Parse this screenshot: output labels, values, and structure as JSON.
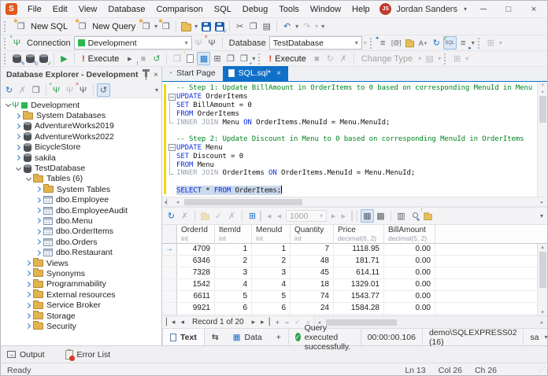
{
  "titlebar": {
    "menus": [
      "File",
      "Edit",
      "View",
      "Database",
      "Comparison",
      "SQL",
      "Debug",
      "Tools",
      "Window",
      "Help"
    ],
    "user": "Jordan Sanders",
    "user_initials": "JS"
  },
  "icons": {
    "plug": "Ψ",
    "undo": "↶",
    "redo": "↷",
    "cut": "✂",
    "copy": "❐",
    "paste": "▤",
    "refresh": "↻",
    "cancel": "✗",
    "accept": "✓",
    "reject": "✗",
    "play": "▶",
    "stop": "■",
    "history": "↺",
    "chev": "▾",
    "star": "✱",
    "win": "❐",
    "grid": "▦",
    "cards": "▩",
    "cols": "▥",
    "export": "↑",
    "swap": "⇆",
    "at": "[@]",
    "aplus": "A+",
    "sql": "SQL",
    "outdent": "≡",
    "pencil": "✎",
    "clock": "↻",
    "check": "✓",
    "arrow": "→",
    "tri_l": "◂",
    "tri_r": "▸",
    "tri_u": "▴",
    "tri_d": "▾",
    "plus": "+",
    "minus": "−",
    "cross": "×",
    "min": "─",
    "max": "□",
    "close": "×",
    "excl": "!",
    "split": "÷",
    "gear": "⊞"
  },
  "toolbar1": {
    "new_sql": "New SQL",
    "new_query": "New Query"
  },
  "toolbar2": {
    "connection_label": "Connection",
    "connection_value": "Development",
    "database_label": "Database",
    "database_value": "TestDatabase"
  },
  "toolbar3": {
    "execute1": "Execute",
    "execute2": "Execute",
    "change_type": "Change Type"
  },
  "explorer": {
    "title": "Database Explorer - Development",
    "tree": [
      {
        "label": "Development",
        "level": 0,
        "icon": "server",
        "expand": "open"
      },
      {
        "label": "System Databases",
        "level": 1,
        "icon": "folder",
        "expand": "closed"
      },
      {
        "label": "AdventureWorks2019",
        "level": 1,
        "icon": "db",
        "expand": "closed"
      },
      {
        "label": "AdventureWorks2022",
        "level": 1,
        "icon": "db",
        "expand": "closed"
      },
      {
        "label": "BicycleStore",
        "level": 1,
        "icon": "db",
        "expand": "closed"
      },
      {
        "label": "sakila",
        "level": 1,
        "icon": "db",
        "expand": "closed"
      },
      {
        "label": "TestDatabase",
        "level": 1,
        "icon": "db",
        "expand": "open"
      },
      {
        "label": "Tables (6)",
        "level": 2,
        "icon": "folder-open",
        "expand": "open"
      },
      {
        "label": "System Tables",
        "level": 3,
        "icon": "folder",
        "expand": "closed"
      },
      {
        "label": "dbo.Employee",
        "level": 3,
        "icon": "table",
        "expand": "closed"
      },
      {
        "label": "dbo.EmployeeAudit",
        "level": 3,
        "icon": "table",
        "expand": "closed"
      },
      {
        "label": "dbo.Menu",
        "level": 3,
        "icon": "table",
        "expand": "closed"
      },
      {
        "label": "dbo.OrderItems",
        "level": 3,
        "icon": "table",
        "expand": "closed"
      },
      {
        "label": "dbo.Orders",
        "level": 3,
        "icon": "table",
        "expand": "closed"
      },
      {
        "label": "dbo.Restaurant",
        "level": 3,
        "icon": "table",
        "expand": "closed"
      },
      {
        "label": "Views",
        "level": 2,
        "icon": "folder",
        "expand": "closed"
      },
      {
        "label": "Synonyms",
        "level": 2,
        "icon": "folder",
        "expand": "closed"
      },
      {
        "label": "Programmability",
        "level": 2,
        "icon": "folder",
        "expand": "closed"
      },
      {
        "label": "External resources",
        "level": 2,
        "icon": "folder",
        "expand": "closed"
      },
      {
        "label": "Service Broker",
        "level": 2,
        "icon": "folder",
        "expand": "closed"
      },
      {
        "label": "Storage",
        "level": 2,
        "icon": "folder",
        "expand": "closed"
      },
      {
        "label": "Security",
        "level": 2,
        "icon": "folder",
        "expand": "closed"
      }
    ]
  },
  "editor": {
    "tabs": [
      {
        "label": "Start Page"
      },
      {
        "label": "SQL.sql*"
      }
    ],
    "code": [
      {
        "fold": "",
        "toks": [
          [
            "c",
            "-- Step 1: Update BillAmount in OrderItems to 0 based on corresponding MenuId in Menu"
          ]
        ]
      },
      {
        "fold": "start",
        "toks": [
          [
            "k",
            "UPDATE"
          ],
          [
            "p",
            " OrderItems"
          ]
        ]
      },
      {
        "fold": "mid",
        "toks": [
          [
            "k",
            "SET"
          ],
          [
            "p",
            " BillAmount = 0"
          ]
        ]
      },
      {
        "fold": "mid",
        "toks": [
          [
            "k",
            "FROM"
          ],
          [
            "p",
            " OrderItems"
          ]
        ]
      },
      {
        "fold": "end",
        "toks": [
          [
            "g",
            "INNER JOIN"
          ],
          [
            "p",
            " Menu "
          ],
          [
            "k",
            "ON"
          ],
          [
            "p",
            " OrderItems.MenuId = Menu.MenuId;"
          ]
        ]
      },
      {
        "fold": "",
        "toks": []
      },
      {
        "fold": "",
        "toks": [
          [
            "c",
            "-- Step 2: Update Discount in Menu to 0 based on corresponding MenuId in OrderItems"
          ]
        ]
      },
      {
        "fold": "start",
        "toks": [
          [
            "k",
            "UPDATE"
          ],
          [
            "p",
            " Menu"
          ]
        ]
      },
      {
        "fold": "mid",
        "toks": [
          [
            "k",
            "SET"
          ],
          [
            "p",
            " Discount = 0"
          ]
        ]
      },
      {
        "fold": "mid",
        "toks": [
          [
            "k",
            "FROM"
          ],
          [
            "p",
            " Menu"
          ]
        ]
      },
      {
        "fold": "end",
        "toks": [
          [
            "g",
            "INNER JOIN"
          ],
          [
            "p",
            " OrderItems "
          ],
          [
            "k",
            "ON"
          ],
          [
            "p",
            " OrderItems.MenuId = Menu.MenuId;"
          ]
        ]
      },
      {
        "fold": "",
        "toks": []
      },
      {
        "fold": "",
        "sel": true,
        "caret": true,
        "toks": [
          [
            "k",
            "SELECT"
          ],
          [
            "p",
            " * "
          ],
          [
            "k",
            "FROM"
          ],
          [
            "p",
            " OrderItems;"
          ]
        ]
      }
    ]
  },
  "results": {
    "page_size": "1000",
    "columns": [
      {
        "name": "OrderId",
        "type": "int"
      },
      {
        "name": "ItemId",
        "type": "int"
      },
      {
        "name": "MenuId",
        "type": "int"
      },
      {
        "name": "Quantity",
        "type": "int"
      },
      {
        "name": "Price",
        "type": "decimal(6, 2)"
      },
      {
        "name": "BillAmount",
        "type": "decimal(5, 2)"
      }
    ],
    "rows": [
      [
        "4709",
        "1",
        "1",
        "7",
        "1118.95",
        "0.00"
      ],
      [
        "6346",
        "2",
        "2",
        "48",
        "181.71",
        "0.00"
      ],
      [
        "7328",
        "3",
        "3",
        "45",
        "614.11",
        "0.00"
      ],
      [
        "1542",
        "4",
        "4",
        "18",
        "1329.01",
        "0.00"
      ],
      [
        "6611",
        "5",
        "5",
        "74",
        "1543.77",
        "0.00"
      ],
      [
        "9921",
        "6",
        "6",
        "24",
        "1584.28",
        "0.00"
      ]
    ],
    "record_status": "Record 1 of 20",
    "tabs": {
      "text": "Text",
      "data": "Data",
      "add": "+"
    },
    "status_message": "Query executed successfully.",
    "exec_time": "00:00:00.106",
    "server": "demo\\SQLEXPRESS02 (16)",
    "db_user": "sa"
  },
  "bottom_tabs": {
    "output": "Output",
    "error_list": "Error List"
  },
  "statusbar": {
    "ready": "Ready",
    "ln": "Ln 13",
    "col": "Col 26",
    "ch": "Ch 26"
  }
}
